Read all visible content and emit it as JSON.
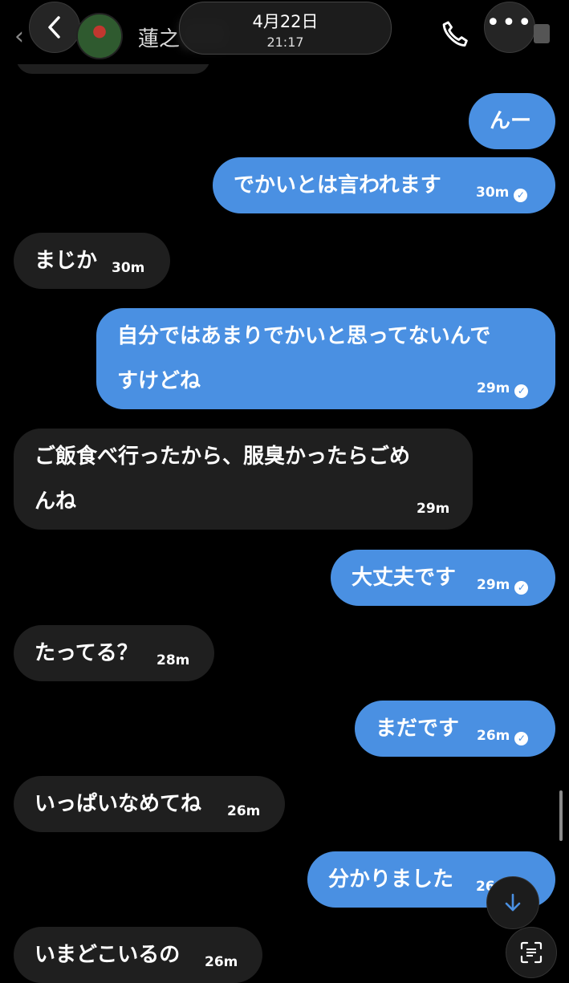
{
  "header": {
    "contact_name": "蓮之",
    "date": "4月22日",
    "time": "21:17",
    "back_icon": "chevron-left-icon",
    "call_icon": "phone-icon",
    "more_icon": "more-dots-icon",
    "more_label": "•••"
  },
  "messages": [
    {
      "dir": "out",
      "text": "んー",
      "time": ""
    },
    {
      "dir": "out",
      "text": "でかいとは言われます",
      "time": "30m"
    },
    {
      "dir": "in",
      "text": "まじか",
      "time": "30m"
    },
    {
      "dir": "out",
      "line1": "自分ではあまりでかいと思ってないんで",
      "line2": "すけどね",
      "time": "29m"
    },
    {
      "dir": "in",
      "line1": "ご飯食べ行ったから、服臭かったらごめ",
      "line2": "んね",
      "time": "29m"
    },
    {
      "dir": "out",
      "text": "大丈夫です",
      "time": "29m"
    },
    {
      "dir": "in",
      "text": "たってる？",
      "time": "28m"
    },
    {
      "dir": "out",
      "text": "まだです",
      "time": "26m"
    },
    {
      "dir": "in",
      "text": "いっぱいなめてね",
      "time": "26m"
    },
    {
      "dir": "out",
      "text": "分かりました",
      "time": "26m"
    },
    {
      "dir": "in",
      "text": "いまどこいるの",
      "time": "26m"
    }
  ],
  "colors": {
    "outgoing": "#4a90e2",
    "incoming": "#1f1f1f",
    "background": "#000000"
  },
  "controls": {
    "scroll_down_icon": "arrow-down-icon",
    "scan_icon": "scan-text-icon"
  }
}
